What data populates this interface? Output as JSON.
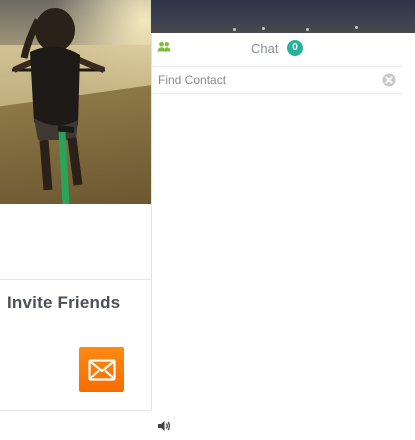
{
  "invite": {
    "title": "Invite Friends",
    "mail_icon": "mail-icon"
  },
  "chat": {
    "title": "Chat",
    "count": "0",
    "contacts_icon": "contacts-icon",
    "search": {
      "placeholder": "Find Contact",
      "value": ""
    },
    "clear_icon": "clear-icon"
  },
  "footer": {
    "sound_icon": "sound-icon"
  },
  "colors": {
    "accent_orange": "#f46d00",
    "badge_green": "#27b39b",
    "contacts_green": "#7dbf3a",
    "text_dark": "#4b4f58",
    "text_muted": "#8a8f98"
  }
}
